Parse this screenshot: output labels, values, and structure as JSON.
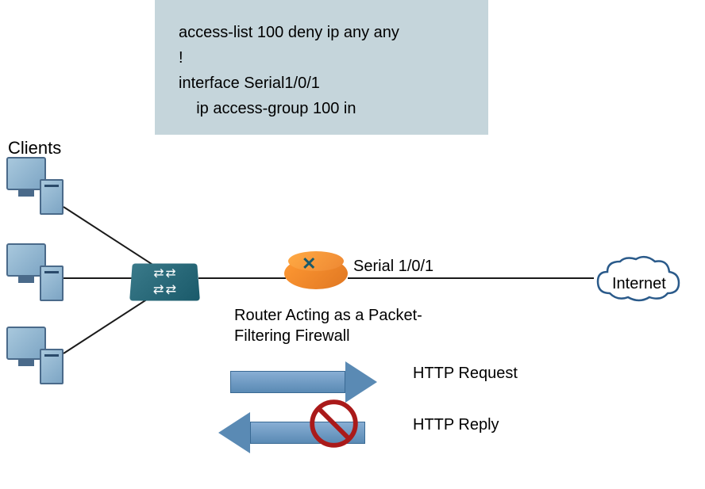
{
  "config_box": {
    "line1": "access-list 100 deny ip any any",
    "line2": "!",
    "line3": "interface Serial1/0/1",
    "line4": "    ip access-group 100 in"
  },
  "labels": {
    "clients": "Clients",
    "interface": "Serial 1/0/1",
    "router_caption": "Router Acting as a Packet-\nFiltering Firewall",
    "internet": "Internet",
    "http_request": "HTTP Request",
    "http_reply": "HTTP Reply"
  }
}
